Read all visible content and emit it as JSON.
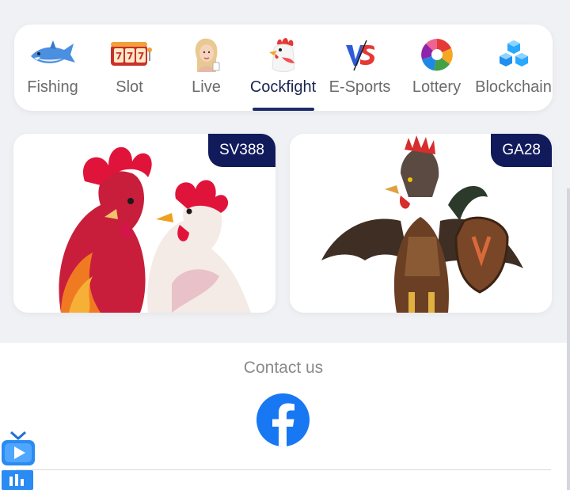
{
  "nav": {
    "tabs": [
      {
        "label": "Fishing",
        "icon": "shark-icon"
      },
      {
        "label": "Slot",
        "icon": "slot-machine-icon"
      },
      {
        "label": "Live",
        "icon": "live-dealer-icon"
      },
      {
        "label": "Cockfight",
        "icon": "rooster-icon",
        "active": true
      },
      {
        "label": "E-Sports",
        "icon": "versus-icon"
      },
      {
        "label": "Lottery",
        "icon": "lottery-wheel-icon"
      },
      {
        "label": "Blockchain",
        "icon": "blockchain-cubes-icon"
      }
    ]
  },
  "games": [
    {
      "provider": "SV388",
      "image": "two-roosters-illustration"
    },
    {
      "provider": "GA28",
      "image": "armored-rooster-illustration"
    }
  ],
  "footer": {
    "contact_title": "Contact us",
    "social": [
      {
        "name": "facebook-icon"
      }
    ]
  },
  "colors": {
    "page_bg": "#f0f1f5",
    "active_tab_text": "#1a2450",
    "active_underline": "#1d2a6b",
    "badge_bg": "#111b5c",
    "facebook_blue": "#1877f2"
  }
}
